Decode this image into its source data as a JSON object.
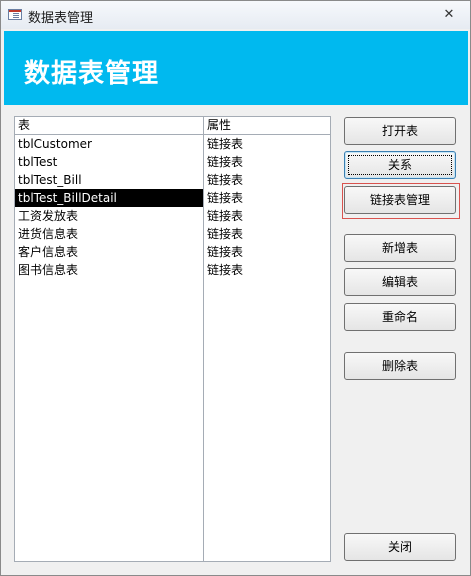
{
  "window": {
    "title": "数据表管理",
    "close_glyph": "✕"
  },
  "banner": {
    "title": "数据表管理"
  },
  "table": {
    "headers": [
      "表",
      "属性"
    ],
    "rows": [
      {
        "name": "tblCustomer",
        "attr": "链接表"
      },
      {
        "name": "tblTest",
        "attr": "链接表"
      },
      {
        "name": "tblTest_Bill",
        "attr": "链接表"
      },
      {
        "name": "tblTest_BillDetail",
        "attr": "链接表",
        "selected": true
      },
      {
        "name": "工资发放表",
        "attr": "链接表"
      },
      {
        "name": "进货信息表",
        "attr": "链接表"
      },
      {
        "name": "客户信息表",
        "attr": "链接表"
      },
      {
        "name": "图书信息表",
        "attr": "链接表"
      }
    ]
  },
  "buttons": {
    "open": "打开表",
    "relations": "关系",
    "linked_manager": "链接表管理",
    "new_table": "新增表",
    "edit_table": "编辑表",
    "rename": "重命名",
    "delete_table": "删除表",
    "close": "关闭"
  },
  "colors": {
    "banner": "#00b9ef",
    "selection": "#000000",
    "highlight_border": "#d9534f"
  }
}
